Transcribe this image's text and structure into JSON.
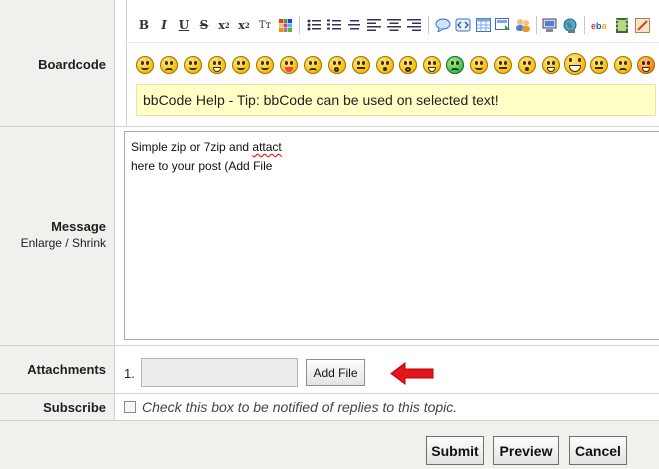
{
  "labels": {
    "boardcode": "Boardcode",
    "message": "Message",
    "enlarge": "Enlarge",
    "slash": " / ",
    "shrink": "Shrink",
    "attachments": "Attachments",
    "subscribe": "Subscribe"
  },
  "toolbar": {
    "bold": "B",
    "italic": "I",
    "underline": "U",
    "strike": "S",
    "subscript": "x",
    "sub_mark": "2",
    "superscript": "x",
    "super_mark": "2",
    "font": "Tт"
  },
  "help": {
    "text": "bbCode Help - Tip: bbCode can be used on selected text!"
  },
  "message": {
    "line1_prefix": "Simple zip or 7zip and ",
    "line1_misspelled": "attact",
    "line2": "here to your post (Add File"
  },
  "attachments": {
    "index": "1.",
    "add_file_label": "Add File"
  },
  "subscribe": {
    "text": "Check this box to be notified of replies to this topic."
  },
  "actions": {
    "submit": "Submit",
    "preview": "Preview",
    "cancel": "Cancel"
  },
  "colors": {
    "arrow": "#e3141b",
    "help_bg": "#ffffc6",
    "label_bg": "#f1f0ed"
  }
}
